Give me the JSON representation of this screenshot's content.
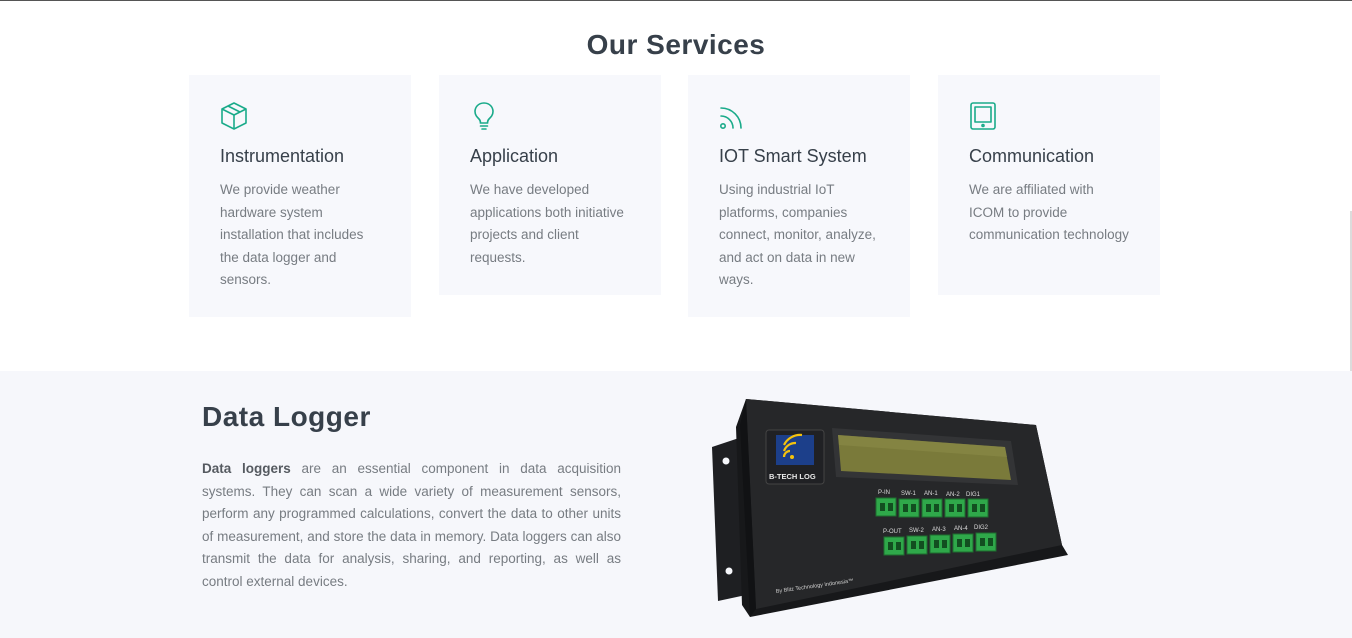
{
  "services": {
    "title": "Our Services",
    "cards": [
      {
        "icon": "box-icon",
        "title": "Instrumentation",
        "text": "We provide weather hardware system installation that includes the data logger and sensors."
      },
      {
        "icon": "lightbulb-icon",
        "title": "Application",
        "text": "We have developed applications both initiative projects and client requests."
      },
      {
        "icon": "rss-icon",
        "title": "IOT Smart System",
        "text": "Using industrial IoT platforms, companies connect, monitor, analyze, and act on data in new ways."
      },
      {
        "icon": "tablet-icon",
        "title": "Communication",
        "text": "We are affiliated with ICOM to provide communication technology"
      }
    ]
  },
  "data_logger": {
    "title": "Data Logger",
    "lead_bold": "Data loggers",
    "text": " are an essential component in data acquisition systems. They can scan a wide variety of measurement sensors, perform any programmed calculations, convert the data to other units of measurement, and store the data in memory. Data loggers can also transmit the data for analysis, sharing, and reporting, as well as control external devices.",
    "device": {
      "brand": "B-TECH LOG",
      "footer": "By Blitz Technology Indonesia™",
      "top_ports": [
        "P-IN",
        "SW-1",
        "AN-1",
        "AN-2",
        "DIG1"
      ],
      "bottom_ports": [
        "P-OUT",
        "SW-2",
        "AN-3",
        "AN-4",
        "DIG2"
      ]
    }
  },
  "colors": {
    "accent": "#1aab8a",
    "heading": "#37404a",
    "body_text": "#777c82",
    "card_bg": "#f7f8fc"
  }
}
